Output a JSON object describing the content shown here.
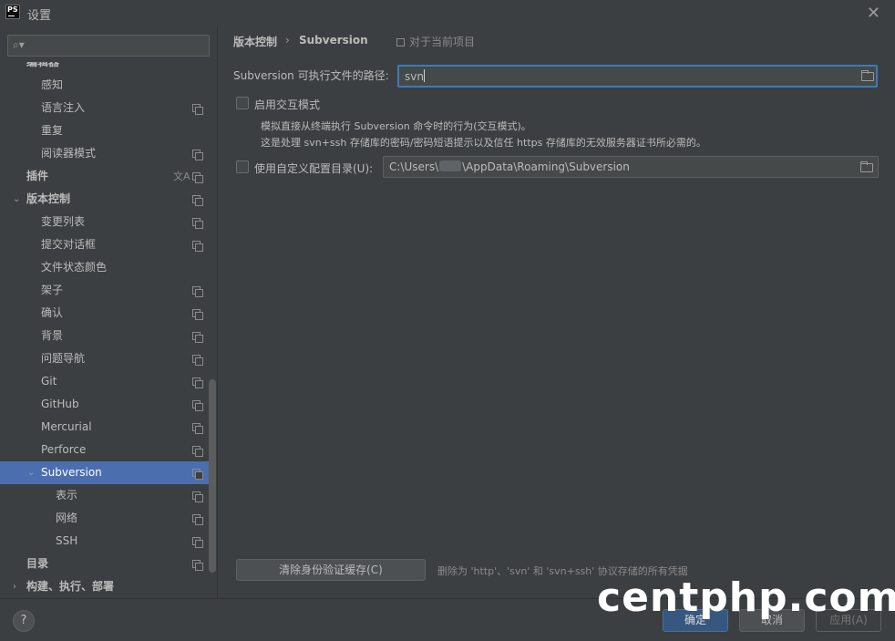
{
  "window": {
    "title": "设置",
    "app_icon_text": "PS"
  },
  "search": {
    "placeholder": ""
  },
  "tree": [
    {
      "label": "编辑器",
      "bold": true
    },
    {
      "label": "感知"
    },
    {
      "label": "语言注入",
      "icon": "project-scope-icon"
    },
    {
      "label": "重复"
    },
    {
      "label": "阅读器模式",
      "icon": "project-scope-icon"
    },
    {
      "label": "插件",
      "bold": true,
      "icon": "translate-icon"
    },
    {
      "label": "版本控制",
      "bold": true,
      "expanded": true,
      "icon": "project-scope-icon"
    },
    {
      "label": "变更列表",
      "icon": "project-scope-icon"
    },
    {
      "label": "提交对话框",
      "icon": "project-scope-icon"
    },
    {
      "label": "文件状态颜色"
    },
    {
      "label": "架子",
      "icon": "project-scope-icon"
    },
    {
      "label": "确认",
      "icon": "project-scope-icon"
    },
    {
      "label": "背景",
      "icon": "project-scope-icon"
    },
    {
      "label": "问题导航",
      "icon": "project-scope-icon"
    },
    {
      "label": "Git",
      "icon": "project-scope-icon"
    },
    {
      "label": "GitHub",
      "icon": "project-scope-icon"
    },
    {
      "label": "Mercurial",
      "icon": "project-scope-icon"
    },
    {
      "label": "Perforce",
      "icon": "project-scope-icon"
    },
    {
      "label": "Subversion",
      "expanded": true,
      "selected": true,
      "icon": "project-scope-icon"
    },
    {
      "label": "表示",
      "icon": "project-scope-icon"
    },
    {
      "label": "网络",
      "icon": "project-scope-icon"
    },
    {
      "label": "SSH",
      "icon": "project-scope-icon"
    },
    {
      "label": "目录",
      "bold": true,
      "icon": "project-scope-icon"
    },
    {
      "label": "构建、执行、部署",
      "bold": true,
      "collapsed": true
    }
  ],
  "breadcrumb": {
    "parent": "版本控制",
    "separator": "›",
    "current": "Subversion",
    "scope_note": "对于当前项目"
  },
  "main": {
    "path_label": "Subversion 可执行文件的路径:",
    "path_value": "svn",
    "interactive_label": "启用交互模式",
    "desc_line1": "模拟直接从终端执行 Subversion 命令时的行为(交互模式)。",
    "desc_line2": "这是处理 svn+ssh 存储库的密码/密码短语提示以及信任 https 存储库的无效服务器证书所必需的。",
    "custom_dir_label": "使用自定义配置目录(U):",
    "custom_dir_prefix": "C:\\Users\\",
    "custom_dir_suffix": "\\AppData\\Roaming\\Subversion",
    "clear_button": "清除身份验证缓存(C)",
    "clear_note": "删除为 'http'、'svn' 和 'svn+ssh' 协议存储的所有凭据"
  },
  "footer": {
    "help": "?",
    "ok": "确定",
    "cancel": "取消",
    "apply": "应用(A)"
  },
  "watermark": "centphp.com",
  "colors": {
    "background": "#3c3f41",
    "selection": "#4b6eaf",
    "focus_border": "#3d7ab8",
    "primary_button": "#365880"
  }
}
